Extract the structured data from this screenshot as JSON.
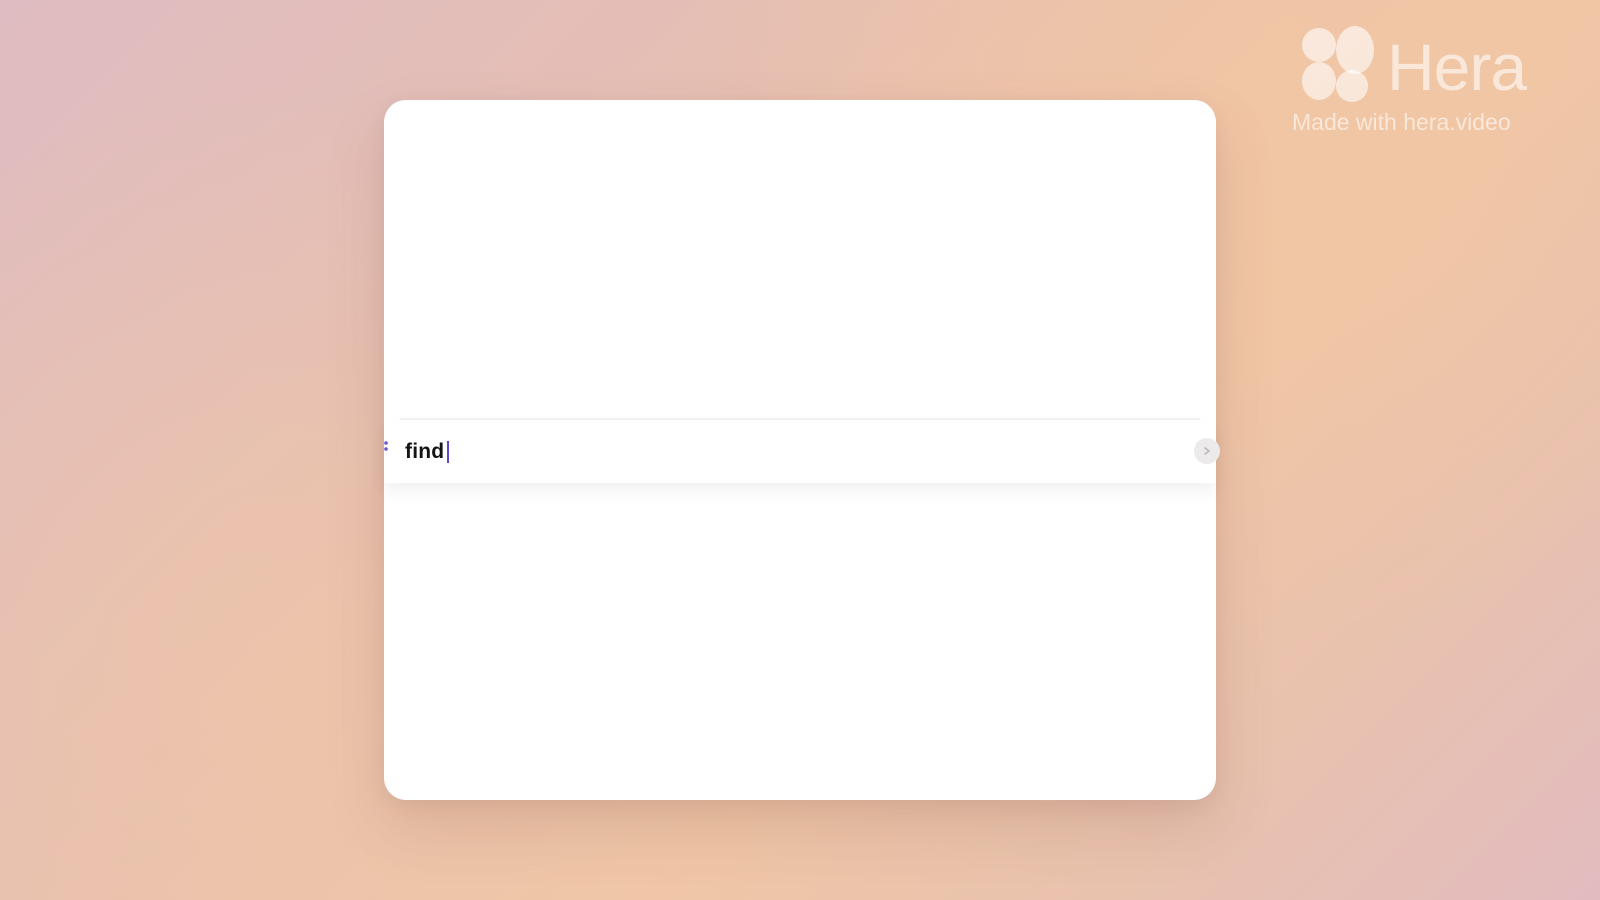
{
  "search": {
    "value": "find"
  },
  "watermark": {
    "brand": "Hera",
    "tagline": "Made with hera.video"
  },
  "icons": {
    "logo": "hera-logo-icon",
    "left_handle": "command-dots-icon",
    "right_button": "chevron-icon"
  },
  "colors": {
    "caret": "#5b4ad0",
    "accent": "#6a58d8"
  }
}
